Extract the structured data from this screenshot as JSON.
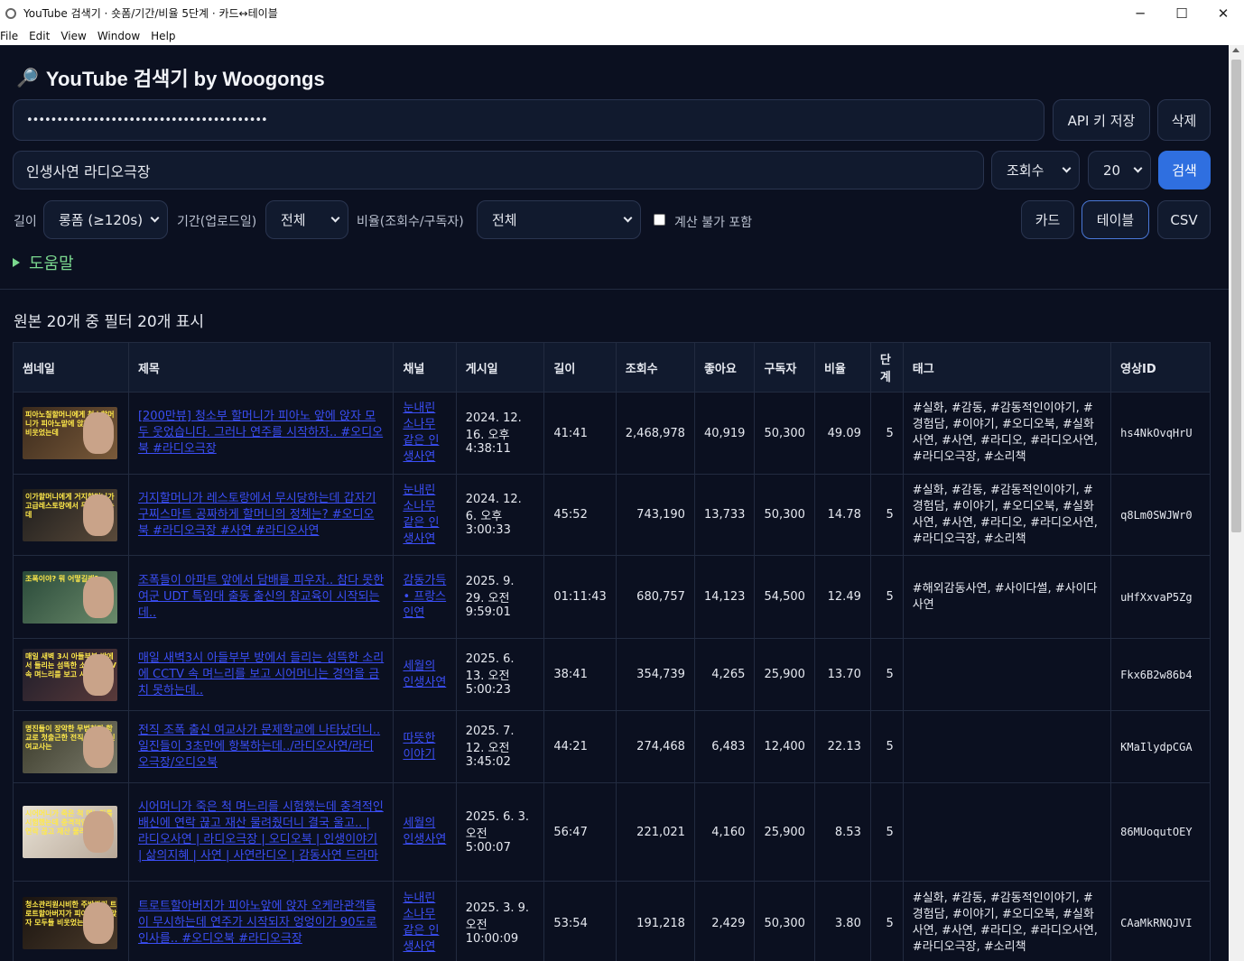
{
  "window": {
    "title": "YouTube 검색기 · 숏폼/기간/비율 5단계 · 카드↔테이블",
    "minimize": "─",
    "maximize": "☐",
    "close": "✕"
  },
  "menu": [
    "File",
    "Edit",
    "View",
    "Window",
    "Help"
  ],
  "header": {
    "icon": "🔎",
    "title": "YouTube 검색기 by Woogongs"
  },
  "api": {
    "key_value": "••••••••••••••••••••••••••••••••••••••••",
    "save_label": "API 키 저장",
    "delete_label": "삭제"
  },
  "search": {
    "query": "인생사연 라디오극장",
    "sort_selected": "조회수",
    "count_selected": "20",
    "search_label": "검색"
  },
  "filters": {
    "length_label": "길이",
    "length_selected": "롱폼 (≥120s)",
    "period_label": "기간(업로드일)",
    "period_selected": "전체",
    "ratio_label": "비율(조회수/구독자)",
    "ratio_selected": "전체",
    "include_uncomputable_label": "계산 불가 포함"
  },
  "view": {
    "card_label": "카드",
    "table_label": "테이블",
    "csv_label": "CSV"
  },
  "help_label": "도움말",
  "summary": "원본 20개 중 필터 20개 표시",
  "table": {
    "headers": [
      "썸네일",
      "제목",
      "채널",
      "게시일",
      "길이",
      "조회수",
      "좋아요",
      "구독자",
      "비율",
      "단계",
      "태그",
      "영상ID"
    ],
    "rows": [
      {
        "thumb_text": "피아노칠할머니에게 청소할머니가 피아노맡에 앉자 모두들 비웃었는데",
        "thumb_colors": [
          "#3a2a1c",
          "#7a5a3a"
        ],
        "title": "[200만뷰] 청소부 할머니가 피아노 앞에 앉자 모두 웃었습니다. 그러나 연주를 시작하자.. #오디오북 #라디오극장",
        "channel": "눈내린 소나무 같은 인생사연",
        "date": "2024. 12. 16. 오후 4:38:11",
        "length": "41:41",
        "views": "2,468,978",
        "likes": "40,919",
        "subs": "50,300",
        "ratio": "49.09",
        "stage": "5",
        "tags": "#실화, #감동, #감동적인이야기, #경험담, #이야기, #오디오북, #실화사연, #사연, #라디오, #라디오사연, #라디오극장, #소리책",
        "vid": "hs4NkOvqHrU"
      },
      {
        "thumb_text": "이가할머니에게 거지할머니가 고급레스토랑에서 무시당하는데",
        "thumb_colors": [
          "#1c1c1c",
          "#5a4a3a"
        ],
        "title": "거지할머니가 레스토랑에서 무시당하는데 갑자기 구찌스마트 공짜하게 할머니의 정체는? #오디오북 #라디오극장 #사연 #라디오사연",
        "channel": "눈내린 소나무 같은 인생사연",
        "date": "2024. 12. 6. 오후 3:00:33",
        "length": "45:52",
        "views": "743,190",
        "likes": "13,733",
        "subs": "50,300",
        "ratio": "14.78",
        "stage": "5",
        "tags": "#실화, #감동, #감동적인이야기, #경험담, #이야기, #오디오북, #실화사연, #사연, #라디오, #라디오사연, #라디오극장, #소리책",
        "vid": "q8Lm0SWJWr0"
      },
      {
        "thumb_text": "조폭이야? 뭐 어떻길래?",
        "thumb_colors": [
          "#2a4a3a",
          "#6a8a6a"
        ],
        "title": "조폭들이 아파트 앞에서 담배를 피우자.. 참다 못한 여군 UDT 특임대 출동 출신의 참교육이 시작되는데..",
        "channel": "감동가득 • 프랑스 인연",
        "date": "2025. 9. 29. 오전 9:59:01",
        "length": "01:11:43",
        "views": "680,757",
        "likes": "14,123",
        "subs": "54,500",
        "ratio": "12.49",
        "stage": "5",
        "tags": "#해외감동사연, #사이다썰, #사이다사연",
        "vid": "uHfXxvaP5Zg"
      },
      {
        "thumb_text": "매일 새벽 3시 아들부부 방에서 들리는 섬뜩한 소리 CCTV속 며느리를 보고 시어머니는",
        "thumb_colors": [
          "#1c1c2a",
          "#5a3a3a"
        ],
        "title": "매일 새벽3시 아들부부 방에서 들리는 섬뜩한 소리에 CCTV 속 며느리를 보고 시어머니는 경악을 금치 못하는데..",
        "channel": "세월의 인생사연",
        "date": "2025. 6. 13. 오전 5:00:23",
        "length": "38:41",
        "views": "354,739",
        "likes": "4,265",
        "subs": "25,900",
        "ratio": "13.70",
        "stage": "5",
        "tags": "",
        "vid": "Fkx6B2w86b4"
      },
      {
        "thumb_text": "명진들이 장악한 무법천지 학교로 첫출근한 전직 조폭 출신 여교사는",
        "thumb_colors": [
          "#3a3a2a",
          "#7a7a6a"
        ],
        "title": "전직 조폭 출신 여교사가 문제학교에 나타났더니.. 일진들이 3초만에 항복하는데../라디오사연/라디오극장/오디오북",
        "channel": "따뜻한 이야기",
        "date": "2025. 7. 12. 오전 3:45:02",
        "length": "44:21",
        "views": "274,468",
        "likes": "6,483",
        "subs": "12,400",
        "ratio": "22.13",
        "stage": "5",
        "tags": "",
        "vid": "KMaIlydpCGA"
      },
      {
        "thumb_text": "시어머니가 죽은 척 며느리를 시험했는데 충격적인 배신에 연락 끊고 재산 물려준",
        "thumb_colors": [
          "#e8e2d6",
          "#b8a898"
        ],
        "title": "시어머니가 죽은 척 며느리를 시험했는데 충격적인 배신에 연락 끊고 재산 물려줬더니 결국 울고.. | 라디오사연 | 라디오극장 | 오디오북 | 인생이야기 | 삶의지혜 | 사연 | 사연라디오 | 감동사연 드라마",
        "channel": "세월의 인생사연",
        "date": "2025. 6. 3. 오전 5:00:07",
        "length": "56:47",
        "views": "221,021",
        "likes": "4,160",
        "subs": "25,900",
        "ratio": "8.53",
        "stage": "5",
        "tags": "",
        "vid": "86MUoqutOEY"
      },
      {
        "thumb_text": "청소관리원시비한 주방관리 트로트할아버지가 피아노앞에 앉자 모두들 비웃었는데",
        "thumb_colors": [
          "#1a1410",
          "#4a3a2a"
        ],
        "title": "트로트할아버지가 피아노앞에 앉자 오케라관객들이 무시하는데 연주가 시작되자 엉엉이가 90도로 인사를.. #오디오북 #라디오극장",
        "channel": "눈내린 소나무 같은 인생사연",
        "date": "2025. 3. 9. 오전 10:00:09",
        "length": "53:54",
        "views": "191,218",
        "likes": "2,429",
        "subs": "50,300",
        "ratio": "3.80",
        "stage": "5",
        "tags": "#실화, #감동, #감동적인이야기, #경험담, #이야기, #오디오북, #실화사연, #사연, #라디오, #라디오사연, #라디오극장, #소리책",
        "vid": "CAaMkRNQJVI"
      }
    ]
  }
}
